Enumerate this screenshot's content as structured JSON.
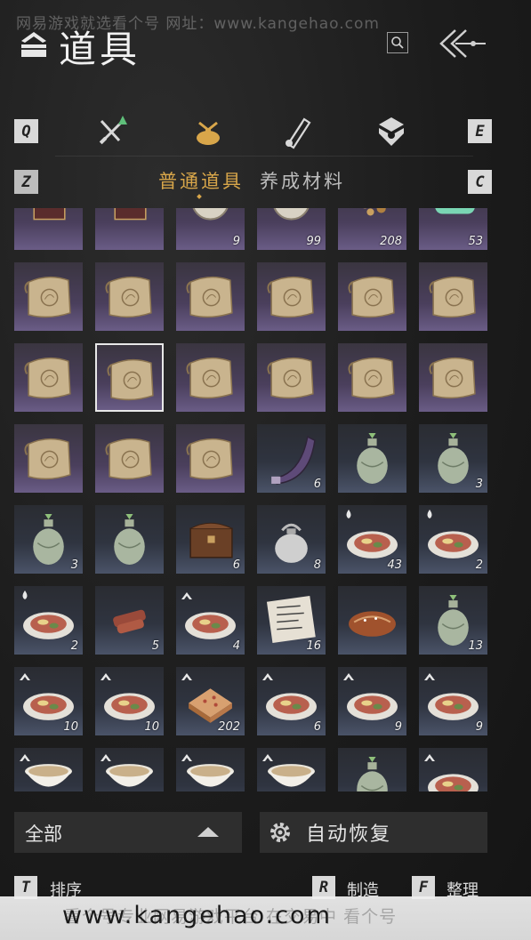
{
  "watermark_top": "网易游戏就选看个号  网址：www.kangehao.com",
  "header": {
    "title": "道具"
  },
  "tabs": {
    "left_key": "Q",
    "right_key": "E",
    "sub_left_key": "Z",
    "sub_right_key": "C",
    "icons": [
      "swords-icon",
      "pouch-icon",
      "scroll-icon",
      "gem-icon"
    ],
    "active_index": 1
  },
  "subtabs": {
    "active": "普通道具",
    "other": "养成材料"
  },
  "items": [
    {
      "icon": "book-icon",
      "bg": "scroll",
      "qty": ""
    },
    {
      "icon": "book-icon",
      "bg": "scroll",
      "qty": ""
    },
    {
      "icon": "token-icon",
      "bg": "scroll",
      "qty": "9"
    },
    {
      "icon": "token-icon",
      "bg": "scroll",
      "qty": "99"
    },
    {
      "icon": "ore-icon",
      "bg": "scroll",
      "qty": "208"
    },
    {
      "icon": "jade-icon",
      "bg": "scroll",
      "qty": "53"
    },
    {
      "icon": "map-scroll-icon",
      "bg": "scroll",
      "qty": ""
    },
    {
      "icon": "map-scroll-icon",
      "bg": "scroll",
      "qty": ""
    },
    {
      "icon": "map-scroll-icon",
      "bg": "scroll",
      "qty": ""
    },
    {
      "icon": "map-scroll-icon",
      "bg": "scroll",
      "qty": ""
    },
    {
      "icon": "map-scroll-icon",
      "bg": "scroll",
      "qty": ""
    },
    {
      "icon": "map-scroll-icon",
      "bg": "scroll",
      "qty": ""
    },
    {
      "icon": "map-scroll-icon",
      "bg": "scroll",
      "qty": ""
    },
    {
      "icon": "map-scroll-icon",
      "bg": "scroll",
      "qty": "",
      "selected": true
    },
    {
      "icon": "map-scroll-icon",
      "bg": "scroll",
      "qty": ""
    },
    {
      "icon": "map-scroll-icon",
      "bg": "scroll",
      "qty": ""
    },
    {
      "icon": "map-scroll-icon",
      "bg": "scroll",
      "qty": ""
    },
    {
      "icon": "map-scroll-icon",
      "bg": "scroll",
      "qty": ""
    },
    {
      "icon": "map-scroll-icon",
      "bg": "scroll",
      "qty": ""
    },
    {
      "icon": "map-scroll-icon",
      "bg": "scroll",
      "qty": ""
    },
    {
      "icon": "map-scroll-icon",
      "bg": "scroll",
      "qty": ""
    },
    {
      "icon": "horn-icon",
      "bg": "cons",
      "qty": "6"
    },
    {
      "icon": "vase-icon",
      "bg": "cons",
      "qty": ""
    },
    {
      "icon": "vase-icon",
      "bg": "cons",
      "qty": "3"
    },
    {
      "icon": "vase-icon",
      "bg": "cons",
      "qty": "3"
    },
    {
      "icon": "vase-icon",
      "bg": "cons",
      "qty": ""
    },
    {
      "icon": "chest-icon",
      "bg": "cons",
      "qty": "6"
    },
    {
      "icon": "sack-icon",
      "bg": "cons",
      "qty": "8"
    },
    {
      "icon": "dish-icon",
      "bg": "cons",
      "qty": "43",
      "badge": "drop"
    },
    {
      "icon": "dish-icon",
      "bg": "cons",
      "qty": "2",
      "badge": "drop"
    },
    {
      "icon": "dish-icon",
      "bg": "cons",
      "qty": "2",
      "badge": "drop"
    },
    {
      "icon": "meat-icon",
      "bg": "cons",
      "qty": "5"
    },
    {
      "icon": "dish-icon",
      "bg": "cons",
      "qty": "4",
      "badge": "up"
    },
    {
      "icon": "recipe-icon",
      "bg": "cons",
      "qty": "16"
    },
    {
      "icon": "pastry-icon",
      "bg": "cons",
      "qty": ""
    },
    {
      "icon": "vase-icon",
      "bg": "cons",
      "qty": "13"
    },
    {
      "icon": "dish-icon",
      "bg": "cons",
      "qty": "10",
      "badge": "up"
    },
    {
      "icon": "dish-icon",
      "bg": "cons",
      "qty": "10",
      "badge": "up"
    },
    {
      "icon": "cake-icon",
      "bg": "cons",
      "qty": "202",
      "badge": "up"
    },
    {
      "icon": "dish-icon",
      "bg": "cons",
      "qty": "6",
      "badge": "up"
    },
    {
      "icon": "dish-icon",
      "bg": "cons",
      "qty": "9",
      "badge": "up"
    },
    {
      "icon": "dish-icon",
      "bg": "cons",
      "qty": "9",
      "badge": "up"
    },
    {
      "icon": "bowl-icon",
      "bg": "cons",
      "qty": "",
      "badge": "up"
    },
    {
      "icon": "bowl-icon",
      "bg": "cons",
      "qty": "",
      "badge": "up"
    },
    {
      "icon": "bowl-icon",
      "bg": "cons",
      "qty": "",
      "badge": "up"
    },
    {
      "icon": "bowl-icon",
      "bg": "cons",
      "qty": "",
      "badge": "up"
    },
    {
      "icon": "vase-icon",
      "bg": "cons",
      "qty": ""
    },
    {
      "icon": "dish-icon",
      "bg": "cons",
      "qty": "",
      "badge": "up"
    }
  ],
  "filter": {
    "label": "全部"
  },
  "auto_recover": {
    "label": "自动恢复"
  },
  "shortcuts": [
    {
      "key": "T",
      "label": "排序"
    },
    {
      "key": "R",
      "label": "制造"
    },
    {
      "key": "F",
      "label": "整理"
    }
  ],
  "bottom_watermark": {
    "faint": "看个号专业网易游戏平台  在交易中  看个号",
    "url": "www.kangehao.com"
  },
  "colors": {
    "accent": "#d8a64a",
    "scroll_bg": "#4a3f5c",
    "consumable_bg": "#2f3440"
  }
}
